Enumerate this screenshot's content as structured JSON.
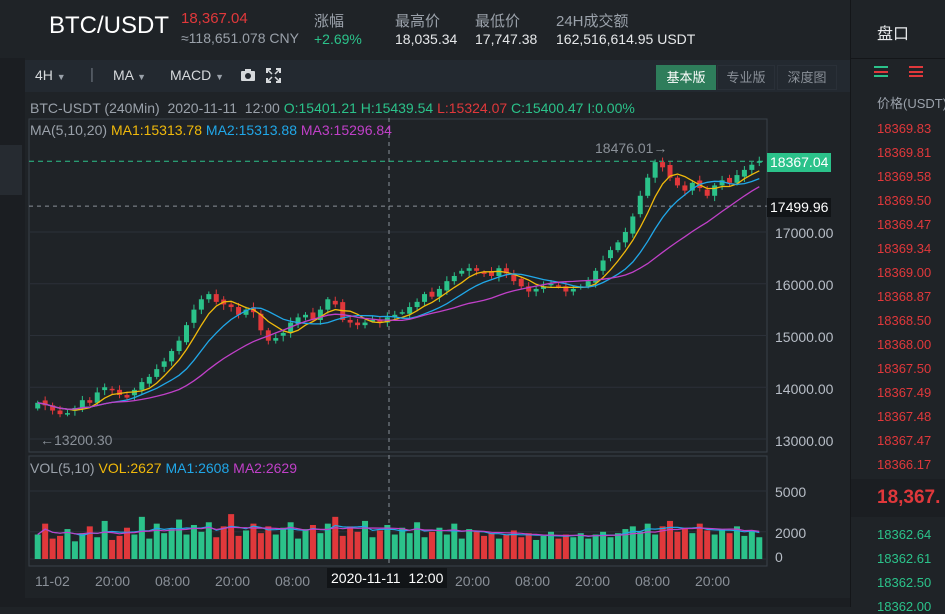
{
  "header": {
    "pair": "BTC/USDT",
    "last_price": "18,367.04",
    "cny_value": "≈118,651.078 CNY",
    "change_label": "涨幅",
    "change_value": "+2.69%",
    "high_label": "最高价",
    "high_value": "18,035.34",
    "low_label": "最低价",
    "low_value": "17,747.38",
    "vol_label": "24H成交额",
    "vol_value": "162,516,614.95 USDT"
  },
  "toolbar": {
    "interval": "4H",
    "indicator1": "MA",
    "indicator2": "MACD",
    "modes": [
      "基本版",
      "专业版",
      "深度图"
    ],
    "active_mode": 0
  },
  "info_line": {
    "symbol": "BTC-USDT",
    "interval": "(240Min)",
    "date": "2020-11-11",
    "time": "12:00",
    "open": "O:15401.21",
    "high": "H:15439.54",
    "low": "L:15324.07",
    "close": "C:15400.47",
    "change": "I:0.00%"
  },
  "ma_legend": {
    "label": "MA(5,10,20)",
    "ma1": "MA1:15313.78",
    "ma2": "MA2:15313.88",
    "ma3": "MA3:15296.84"
  },
  "vol_legend": {
    "label": "VOL(5,10)",
    "vol": "VOL:2627",
    "ma1": "MA1:2608",
    "ma2": "MA2:2629"
  },
  "annotations": {
    "max_label": "18476.01→",
    "min_label": "←13200.30",
    "last_tag": "18367.04",
    "cross_tag": "17499.96",
    "cross_time": "2020-11-11  12:00"
  },
  "colors": {
    "up": "#2bc28a",
    "down": "#e0383b",
    "ma1": "#f0b90b",
    "ma2": "#20a7e8",
    "ma3": "#c040c8",
    "grid": "#2b3038"
  },
  "chart_data": {
    "type": "candlestick",
    "price_axis": [
      "17000.00",
      "16000.00",
      "15000.00",
      "14000.00",
      "13000.00"
    ],
    "price_ticks": [
      17000,
      16000,
      15000,
      14000,
      13000
    ],
    "volume_axis": [
      "5000",
      "2000",
      "0"
    ],
    "volume_ticks": [
      5000,
      2000,
      0
    ],
    "time_axis": [
      "11-02",
      "20:00",
      "08:00",
      "20:00",
      "08:00",
      "20:00",
      "08:00",
      "20:00",
      "08:00",
      "20:00",
      "08:00",
      "20:00"
    ],
    "close_path": [
      13700,
      13650,
      13550,
      13480,
      13500,
      13600,
      13750,
      13700,
      13900,
      14000,
      13950,
      13850,
      13800,
      13950,
      14100,
      14200,
      14350,
      14500,
      14700,
      14900,
      15200,
      15500,
      15700,
      15800,
      15650,
      15600,
      15550,
      15400,
      15500,
      15450,
      15100,
      14900,
      14950,
      15050,
      15250,
      15350,
      15400,
      15300,
      15500,
      15700,
      15600,
      15300,
      15250,
      15200,
      15250,
      15300,
      15250,
      15350,
      15400,
      15450,
      15550,
      15650,
      15800,
      15750,
      15900,
      16050,
      16150,
      16250,
      16300,
      16250,
      16200,
      16150,
      16300,
      16200,
      16050,
      15950,
      15850,
      15900,
      15950,
      16000,
      15950,
      15850,
      15900,
      15950,
      16050,
      16250,
      16450,
      16650,
      16800,
      17000,
      17300,
      17700,
      18050,
      18350,
      18250,
      18050,
      17900,
      17800,
      17950,
      17850,
      17700,
      17900,
      18000,
      17950,
      18100,
      18200,
      18300,
      18367
    ],
    "volume_path": [
      1800,
      2600,
      1500,
      1700,
      2200,
      1300,
      1900,
      2400,
      1600,
      2800,
      1400,
      1700,
      2300,
      1800,
      3100,
      1500,
      2600,
      1900,
      2200,
      2900,
      1800,
      2500,
      2000,
      2700,
      1600,
      2400,
      3300,
      1700,
      2100,
      2600,
      1900,
      2400,
      1800,
      2300,
      2700,
      1500,
      2200,
      2500,
      1900,
      2600,
      3100,
      1700,
      2400,
      2000,
      2800,
      1600,
      2100,
      2500,
      1800,
      2300,
      1900,
      2700,
      1600,
      2000,
      2300,
      1800,
      2600,
      1500,
      2200,
      2000,
      1700,
      1900,
      1500,
      1800,
      2100,
      1600,
      1900,
      1400,
      1700,
      2000,
      1500,
      1800,
      1600,
      1900,
      1500,
      1800,
      2000,
      1600,
      1900,
      2200,
      2400,
      2000,
      2600,
      1800,
      2400,
      2800,
      2000,
      2300,
      1900,
      2600,
      2100,
      1800,
      2200,
      1900,
      2400,
      1700,
      2100,
      1600
    ]
  },
  "orderbook": {
    "title": "盘口",
    "price_header": "价格(USDT)",
    "asks": [
      "18369.83",
      "18369.81",
      "18369.58",
      "18369.50",
      "18369.47",
      "18369.34",
      "18369.00",
      "18368.87",
      "18368.50",
      "18368.00",
      "18367.50",
      "18367.49",
      "18367.48",
      "18367.47",
      "18366.17"
    ],
    "current": "18,367.",
    "bids": [
      "18362.64",
      "18362.61",
      "18362.50",
      "18362.00"
    ]
  }
}
